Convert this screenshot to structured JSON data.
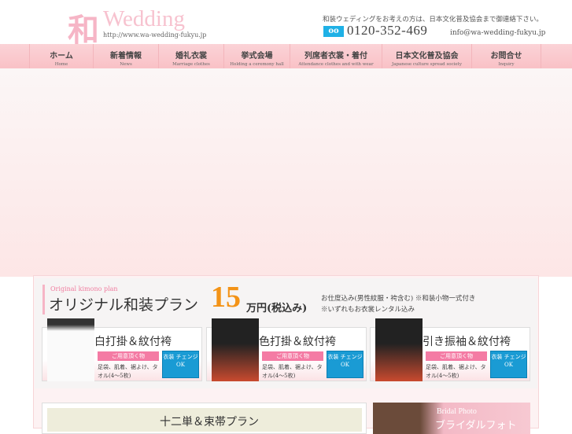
{
  "header": {
    "logo_kanji": "和",
    "logo_word": "Wedding",
    "logo_url": "http://www.wa-wedding-fukyu.jp",
    "notice": "和装ウェディングをお考えの方は、日本文化普及協会まで御連絡下さい。",
    "phone_icon": "oo",
    "phone": "0120-352-469",
    "email": "info@wa-wedding-fukyu.jp"
  },
  "nav": [
    {
      "ja": "ホーム",
      "en": "Home"
    },
    {
      "ja": "新着情報",
      "en": "News"
    },
    {
      "ja": "婚礼衣裳",
      "en": "Marriage clothes"
    },
    {
      "ja": "挙式会場",
      "en": "Holding a ceremony hall"
    },
    {
      "ja": "列席者衣裳・着付",
      "en": "Attendance clothes and with wear"
    },
    {
      "ja": "日本文化普及協会",
      "en": "Japanese culture spread society"
    },
    {
      "ja": "お問合せ",
      "en": "Inquiry"
    }
  ],
  "plan": {
    "en": "Original kimono plan",
    "title": "オリジナル和装プラン",
    "price": "15",
    "unit": "万円(税込み)",
    "note1": "お仕度込み(男性紋服・袴含む) ※和装小物一式付き",
    "note2": "※いずれもお衣裳レンタル込み"
  },
  "cards": [
    {
      "title": "白打掛＆紋付袴",
      "tag": "ご用意頂く物",
      "items": "足袋、肌着、裾よけ、タオル(4～5枚)",
      "change": "衣装 チェンジ OK"
    },
    {
      "title": "色打掛＆紋付袴",
      "tag": "ご用意頂く物",
      "items": "足袋、肌着、裾よけ、タオル(4～5枚)",
      "change": "衣装 チェンジ OK"
    },
    {
      "title": "引き振袖＆紋付袴",
      "tag": "ご用意頂く物",
      "items": "足袋、肌着、裾よけ、タオル(4～5枚)",
      "change": "衣装 チェンジ OK"
    }
  ],
  "juni": {
    "title": "十二単＆束帯プラン"
  },
  "bridal": {
    "en": "Bridal Photo",
    "ja": "ブライダルフォト"
  }
}
